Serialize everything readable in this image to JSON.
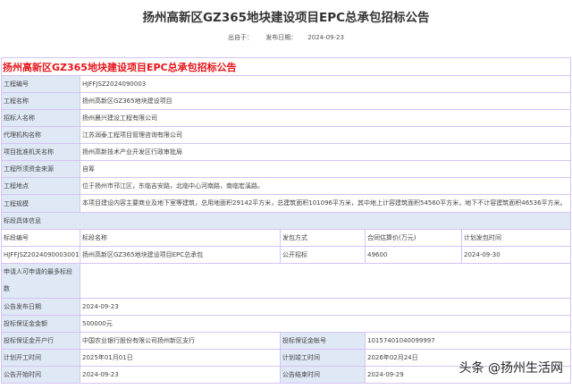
{
  "title": "扬州高新区GZ365地块建设项目EPC总承包招标公告",
  "meta": {
    "source_label": "出自于：",
    "date_label": "发布日期：",
    "date": "2024-09-23"
  },
  "table_title": "扬州高新区GZ365地块建设项目EPC总承包招标公告",
  "info": [
    {
      "label": "工程编号",
      "value": "HJFFJSZ2024090003"
    },
    {
      "label": "工程名称",
      "value": "扬州高新区GZ365地块建设项目"
    },
    {
      "label": "招标人名称",
      "value": "扬州晨兴建设工程有限公司"
    },
    {
      "label": "代理机构名称",
      "value": "江苏润泰工程项目管理咨询有限公司"
    },
    {
      "label": "项目批准机关名称",
      "value": "扬州高新技术产业开发区行政审批局"
    },
    {
      "label": "工程所须资金来源",
      "value": "自筹"
    },
    {
      "label": "工程地点",
      "value": "位于扬州市邗江区，东临吉安路，北临中心河南路，南临宏溪路。"
    },
    {
      "label": "工程规模",
      "value": "本项目建设内容主要商业及地下室等建筑，总用地面积29142平方米，总建筑面积101096平方米，其中地上计容建筑面积54560平方米，地下不计容建筑面积46536平方米。"
    }
  ],
  "section_label": "标段具体信息",
  "lot_headers": [
    "标段编号",
    "标段名称",
    "发包方式",
    "合同估算价(万元)",
    "计划发包时间"
  ],
  "lot_row": [
    "HJFFJSZ2024090003001",
    "扬州高新区GZ365地块建设项目EPC总承包",
    "公开招标",
    "49600",
    "2024-09-30"
  ],
  "max_lots_label": "申请人可申请的最多标段数",
  "max_lots_value": "",
  "publish_date_label": "公告发布日期",
  "publish_date": "2024-09-23",
  "deposit_label": "投标保证金金额",
  "deposit": "500000元",
  "bank_label": "投标保证金开户行",
  "bank": "中国农业银行股份有限公司扬州新区支行",
  "account_label": "投标保证金帐号",
  "account": "10157401040099997",
  "start_label": "计划开工时间",
  "start": "2025年01月01日",
  "finish_label": "计划竣工时间",
  "finish": "2026年02月24日",
  "notice_start_label": "公告开始时间",
  "notice_start": "2024-09-23",
  "notice_end_label": "公告结束时间",
  "notice_end": "2024-09-29",
  "watermark": "头条 @扬州生活网"
}
